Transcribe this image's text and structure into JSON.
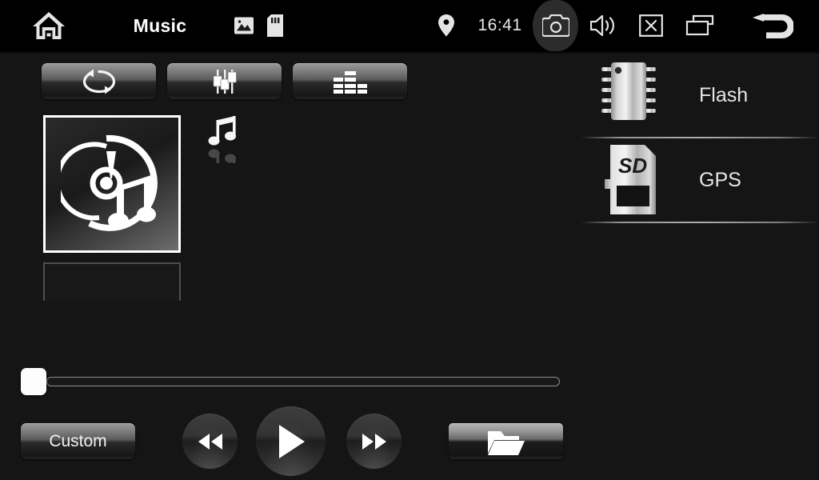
{
  "statusbar": {
    "home_label": "home-icon",
    "title": "Music",
    "gallery_icon": "image-icon",
    "sdcard_icon": "sdcard-icon",
    "location_icon": "location-pin-icon",
    "clock": "16:41",
    "camera_icon": "camera-icon",
    "camera_active": true,
    "volume_icon": "volume-icon",
    "close_icon": "close-box-icon",
    "recents_icon": "recent-apps-icon",
    "back_icon": "back-arrow-icon"
  },
  "toolbar": {
    "buttons": [
      {
        "name": "repeat-button",
        "icon": "repeat-icon"
      },
      {
        "name": "equalizer-button",
        "icon": "faders-icon"
      },
      {
        "name": "playlist-button",
        "icon": "eq-bars-icon"
      }
    ]
  },
  "library": {
    "items": [
      {
        "name": "album-item-selected",
        "icon": "disc-music-icon",
        "selected": true
      },
      {
        "name": "album-item",
        "icon": "",
        "selected": false
      }
    ],
    "now_playing_icon": "music-note-icon"
  },
  "sources": {
    "items": [
      {
        "label": "Flash",
        "icon": "flash-chip-icon"
      },
      {
        "label": "GPS",
        "icon": "sd-card-icon"
      }
    ]
  },
  "player": {
    "progress_percent": 0,
    "seek_name": "seek-bar",
    "custom_label": "Custom",
    "prev_icon": "rewind-icon",
    "play_icon": "play-icon",
    "next_icon": "fast-forward-icon",
    "browse_icon": "folder-icon"
  },
  "colors": {
    "background": "#151515",
    "statusbar_bg": "#000000",
    "accent_white": "#ffffff",
    "text": "#e8e8e8",
    "highlight": "#2c2c2c"
  }
}
